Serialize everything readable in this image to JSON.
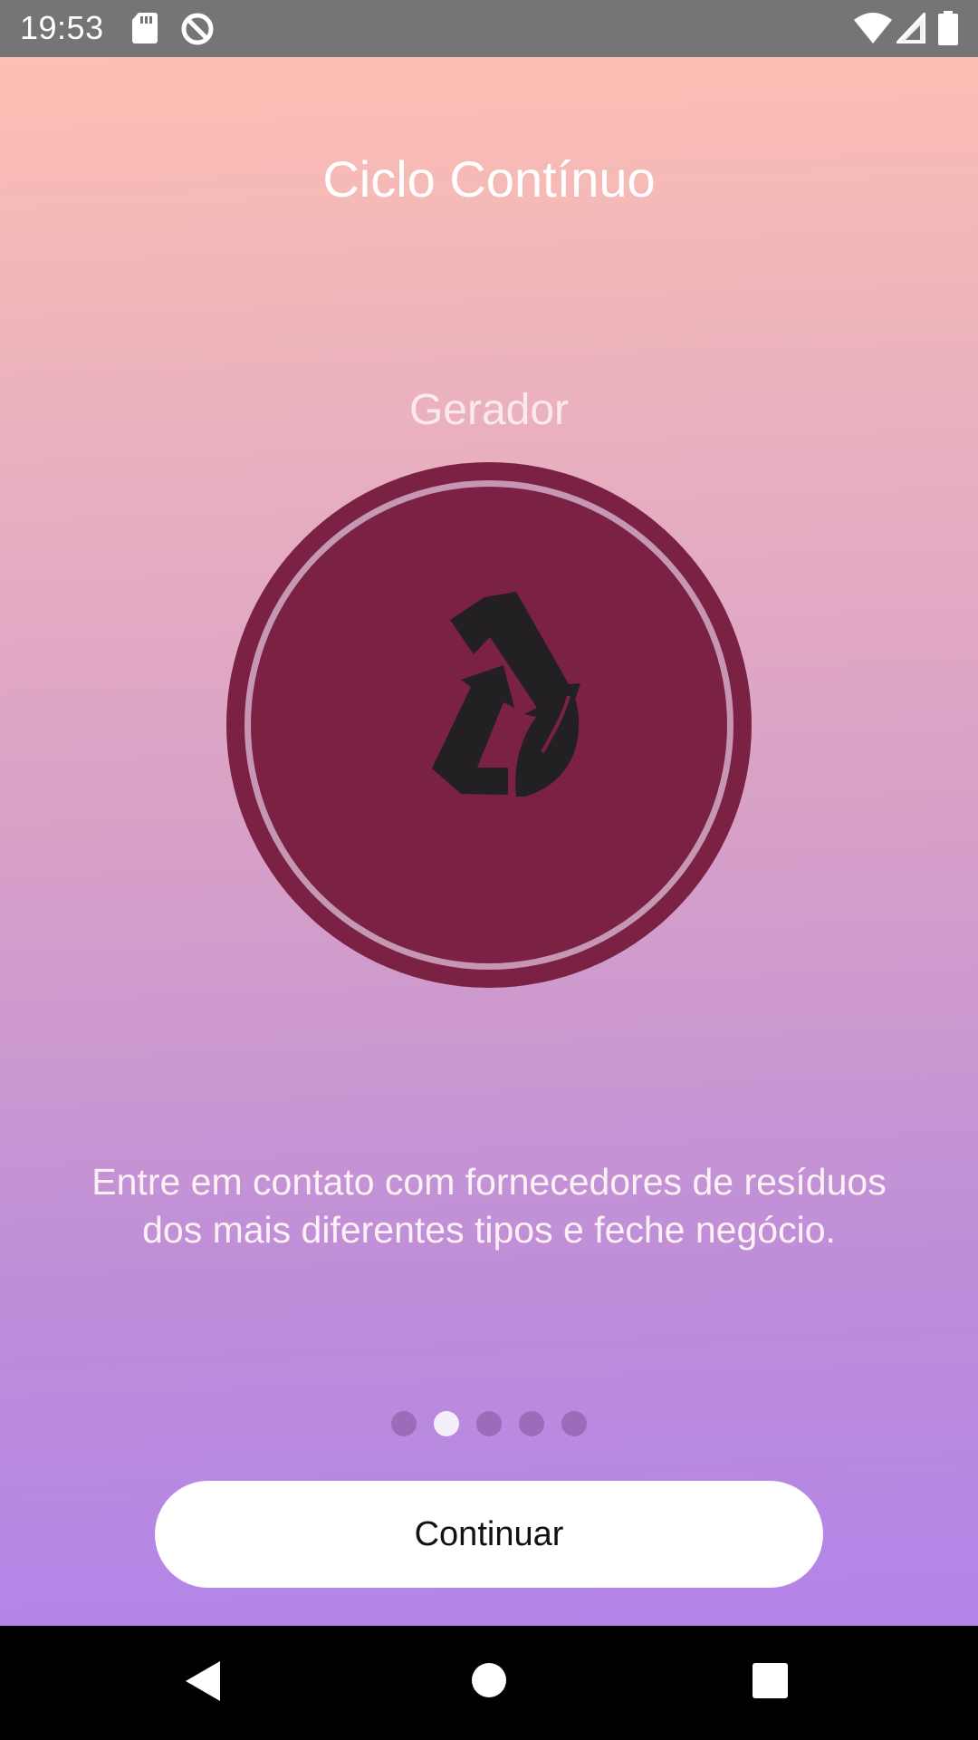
{
  "status_bar": {
    "time": "19:53",
    "left_icons": [
      "sd-card-icon",
      "data-saver-icon"
    ],
    "right_icons": [
      "wifi-icon",
      "cell-signal-icon",
      "battery-icon"
    ]
  },
  "app": {
    "title": "Ciclo Contínuo",
    "slide": {
      "label": "Gerador",
      "icon": "recycle-leaf-icon",
      "description": "Entre em contato com fornecedores de resíduos dos mais diferentes tipos e feche negócio."
    },
    "pagination": {
      "total": 5,
      "active_index": 1
    },
    "continue_label": "Continuar"
  },
  "colors": {
    "circle_fill": "#7a2144",
    "circle_ring": "#c597b2",
    "icon_color": "#222022",
    "gradient_top": "#fdbfb2",
    "gradient_bottom": "#b284e8"
  },
  "nav_bar": {
    "buttons": [
      "back-icon",
      "home-icon",
      "recents-icon"
    ]
  }
}
